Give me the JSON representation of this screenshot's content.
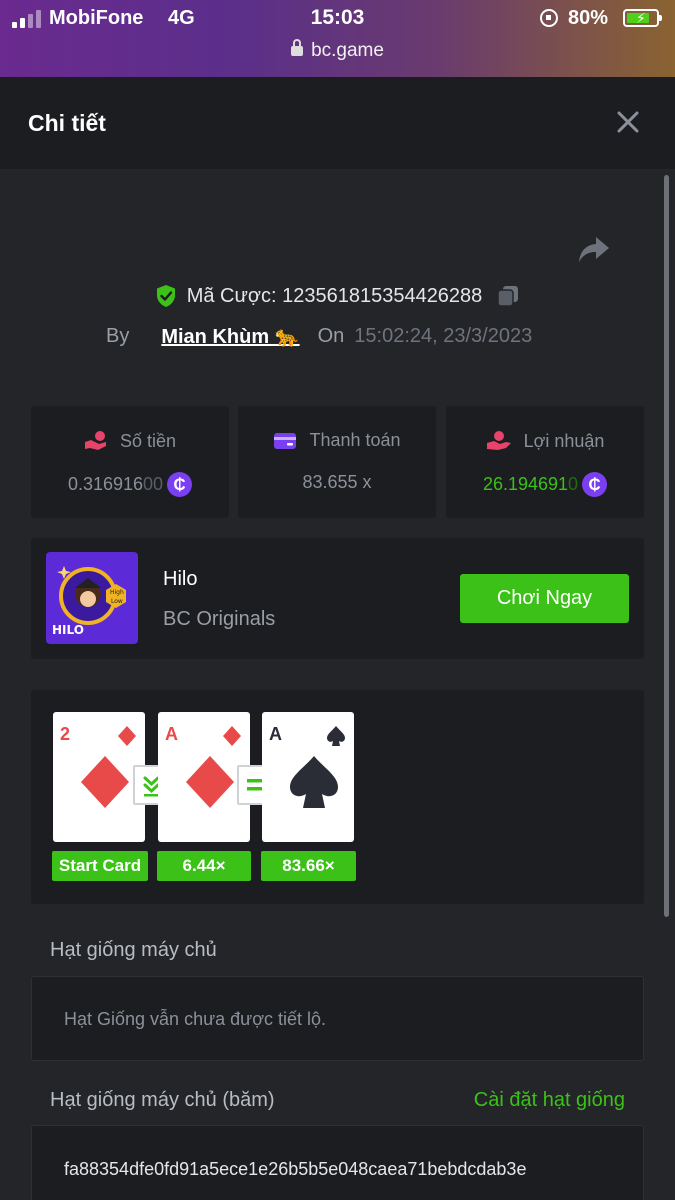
{
  "status_bar": {
    "carrier": "MobiFone",
    "network": "4G",
    "time": "15:03",
    "url": "bc.game",
    "battery_percent_label": "80%",
    "battery_level": 0.8,
    "icons": [
      "signal-icon",
      "lock-icon",
      "rotation-lock-icon",
      "battery-charging-icon"
    ]
  },
  "header": {
    "title": "Chi tiết",
    "close_icon": "close-icon"
  },
  "bet": {
    "id_label": "Mã Cược: 123561815354426288",
    "by_label": "By",
    "user": "Mian Khùm 🐆",
    "on_label": "On",
    "datetime": "15:02:24, 23/3/2023",
    "verified_color": "#3bc117"
  },
  "stats": {
    "amount": {
      "label": "Số tiền",
      "value_main": "0.316916",
      "value_dim": "00",
      "icon": "hand-coins-icon",
      "icon_color": "#e8436a"
    },
    "payout": {
      "label": "Thanh toán",
      "value": "83.655 x",
      "icon": "wallet-icon",
      "icon_color": "#7b3ff2"
    },
    "profit": {
      "label": "Lợi nhuận",
      "value_main": "26.194691",
      "value_dim": "0",
      "icon": "profit-hand-icon",
      "icon_color": "#e8436a",
      "value_color": "#3bc117"
    },
    "currency_symbol": "₵"
  },
  "game": {
    "thumb_label": "HILO",
    "thumb_hi": "High",
    "thumb_lo": "Low",
    "name": "Hilo",
    "provider": "BC Originals",
    "play_label": "Chơi Ngay",
    "accent": "#3bc117"
  },
  "cards": [
    {
      "rank": "2",
      "suit": "diamond",
      "color": "#e84a4a",
      "multiplier": "Start Card"
    },
    {
      "rank": "A",
      "suit": "diamond",
      "color": "#e84a4a",
      "multiplier": "6.44×",
      "connector": "lower-icon"
    },
    {
      "rank": "A",
      "suit": "spade",
      "color": "#2a2c36",
      "multiplier": "83.66×",
      "connector": "equal-icon"
    }
  ],
  "seeds": {
    "server_label": "Hạt giống máy chủ",
    "server_value": "Hạt Giống vẫn chưa được tiết lộ.",
    "hashed_label": "Hạt giống máy chủ (băm)",
    "settings_link": "Cài đặt hạt giống",
    "hashed_value": "fa88354dfe0fd91a5ece1e26b5b5e048caea71bebdcdab3e"
  }
}
